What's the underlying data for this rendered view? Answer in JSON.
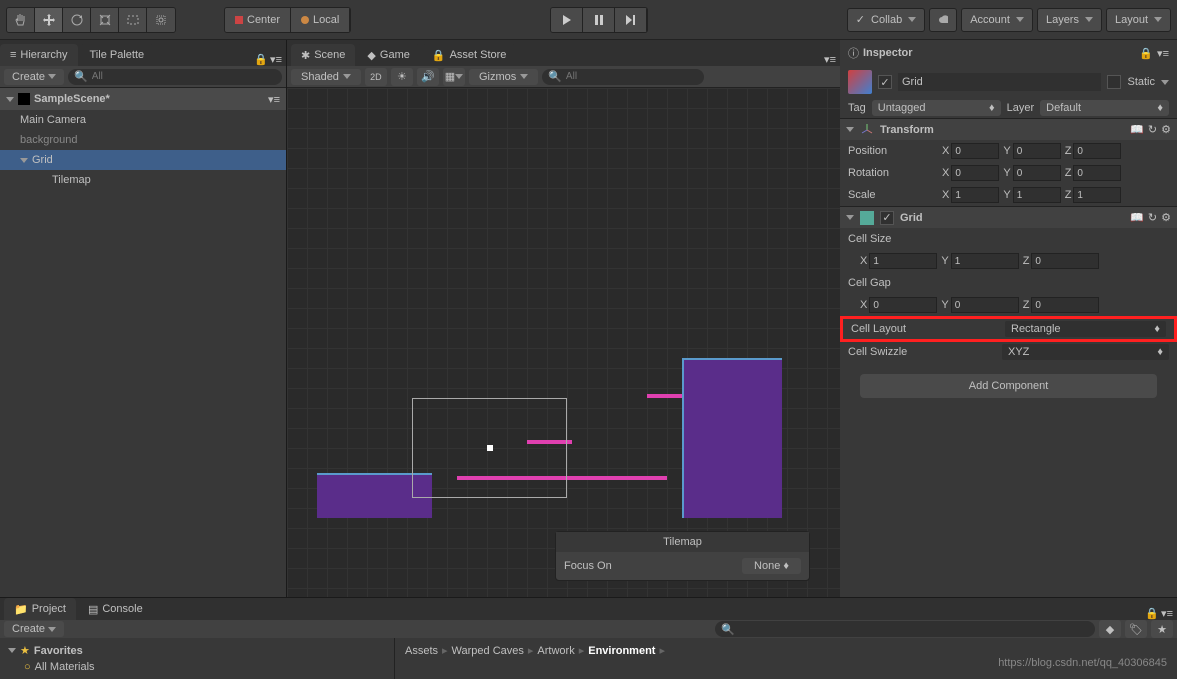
{
  "toolbar": {
    "pivot_center": "Center",
    "pivot_local": "Local",
    "collab": "Collab",
    "account": "Account",
    "layers": "Layers",
    "layout": "Layout"
  },
  "hierarchy": {
    "tab_label": "Hierarchy",
    "tile_palette_tab": "Tile Palette",
    "create": "Create",
    "search_placeholder": "All",
    "scene_name": "SampleScene*",
    "items": [
      "Main Camera",
      "background",
      "Grid",
      "Tilemap"
    ]
  },
  "scene": {
    "tab_scene": "Scene",
    "tab_game": "Game",
    "tab_asset": "Asset Store",
    "shaded": "Shaded",
    "mode_2d": "2D",
    "gizmos": "Gizmos",
    "search_placeholder": "All",
    "tilemap_label": "Tilemap",
    "focus_on": "Focus On",
    "none": "None"
  },
  "inspector": {
    "title": "Inspector",
    "obj_name": "Grid",
    "static": "Static",
    "tag_label": "Tag",
    "tag_value": "Untagged",
    "layer_label": "Layer",
    "layer_value": "Default",
    "transform": {
      "title": "Transform",
      "position": {
        "label": "Position",
        "x": "0",
        "y": "0",
        "z": "0"
      },
      "rotation": {
        "label": "Rotation",
        "x": "0",
        "y": "0",
        "z": "0"
      },
      "scale": {
        "label": "Scale",
        "x": "1",
        "y": "1",
        "z": "1"
      }
    },
    "grid": {
      "title": "Grid",
      "cell_size": {
        "label": "Cell Size",
        "x": "1",
        "y": "1",
        "z": "0"
      },
      "cell_gap": {
        "label": "Cell Gap",
        "x": "0",
        "y": "0",
        "z": "0"
      },
      "cell_layout": {
        "label": "Cell Layout",
        "value": "Rectangle"
      },
      "cell_swizzle": {
        "label": "Cell Swizzle",
        "value": "XYZ"
      }
    },
    "add_component": "Add Component"
  },
  "project": {
    "tab_project": "Project",
    "tab_console": "Console",
    "create": "Create",
    "favorites": "Favorites",
    "all_materials": "All Materials",
    "breadcrumb": [
      "Assets",
      "Warped Caves",
      "Artwork",
      "Environment"
    ]
  },
  "watermark": "https://blog.csdn.net/qq_40306845"
}
